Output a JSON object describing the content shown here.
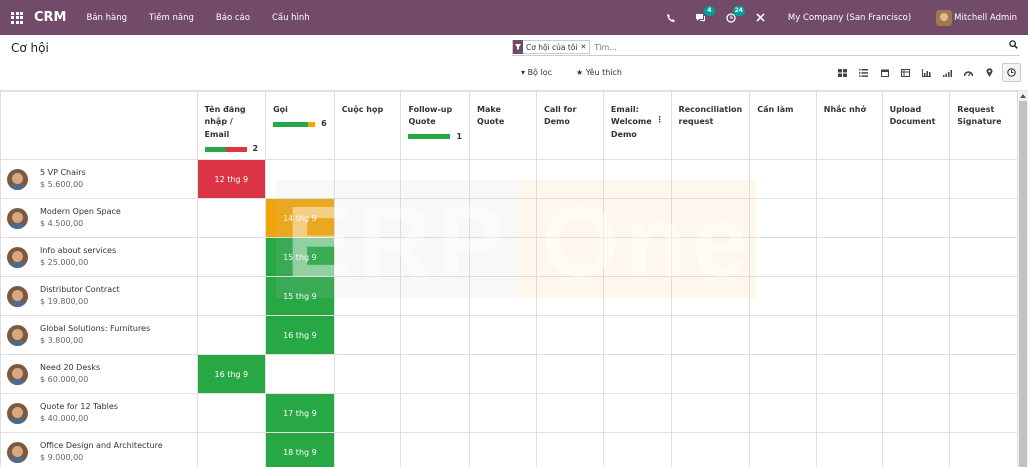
{
  "navbar": {
    "brand": "CRM",
    "menu": [
      "Bán hàng",
      "Tiềm năng",
      "Báo cáo",
      "Cấu hình"
    ],
    "messages_count": "4",
    "activities_count": "24",
    "company": "My Company (San Francisco)",
    "user": "Mitchell Admin"
  },
  "control": {
    "title": "Cơ hội",
    "facet_label": "Cơ hội của tôi",
    "search_placeholder": "Tìm...",
    "filter_label": "Bộ lọc",
    "favorites_label": "Yêu thích",
    "views": [
      "kanban",
      "list",
      "calendar",
      "pivot",
      "graph",
      "cohort",
      "dashboard",
      "map",
      "activity"
    ],
    "active_view": "activity"
  },
  "columns": [
    {
      "label": "Tên đăng nhập / Email",
      "progress": {
        "segments": [
          {
            "color": "#28a745",
            "fraction": 0.5
          },
          {
            "color": "#dc3545",
            "fraction": 0.5
          }
        ],
        "count": "2"
      }
    },
    {
      "label": "Gọi",
      "progress": {
        "segments": [
          {
            "color": "#28a745",
            "fraction": 0.83
          },
          {
            "color": "#f0a30a",
            "fraction": 0.17
          }
        ],
        "count": "6"
      }
    },
    {
      "label": "Cuộc họp"
    },
    {
      "label": "Follow-up Quote",
      "progress": {
        "segments": [
          {
            "color": "#28a745",
            "fraction": 1
          }
        ],
        "count": "1"
      }
    },
    {
      "label": "Make Quote"
    },
    {
      "label": "Call for Demo"
    },
    {
      "label": "Email: Welcome Demo",
      "has_menu": true
    },
    {
      "label": "Reconciliation request"
    },
    {
      "label": "Cần làm"
    },
    {
      "label": "Nhắc nhở"
    },
    {
      "label": "Upload Document"
    },
    {
      "label": "Request Signature"
    }
  ],
  "rows": [
    {
      "name": "5 VP Chairs",
      "amount": "$ 5.600,00",
      "cells": {
        "0": {
          "date": "12 thg 9",
          "status": "overdue"
        }
      }
    },
    {
      "name": "Modern Open Space",
      "amount": "$ 4.500,00",
      "cells": {
        "1": {
          "date": "14 thg 9",
          "status": "today"
        }
      }
    },
    {
      "name": "Info about services",
      "amount": "$ 25.000,00",
      "cells": {
        "1": {
          "date": "15 thg 9",
          "status": "planned"
        }
      }
    },
    {
      "name": "Distributor Contract",
      "amount": "$ 19.800,00",
      "cells": {
        "1": {
          "date": "15 thg 9",
          "status": "planned"
        }
      }
    },
    {
      "name": "Global Solutions: Furnitures",
      "amount": "$ 3.800,00",
      "cells": {
        "1": {
          "date": "16 thg 9",
          "status": "planned"
        }
      }
    },
    {
      "name": "Need 20 Desks",
      "amount": "$ 60.000,00",
      "cells": {
        "0": {
          "date": "16 thg 9",
          "status": "planned"
        }
      }
    },
    {
      "name": "Quote for 12 Tables",
      "amount": "$ 40.000,00",
      "cells": {
        "1": {
          "date": "17 thg 9",
          "status": "planned"
        }
      }
    },
    {
      "name": "Office Design and Architecture",
      "amount": "$ 9.000,00",
      "cells": {
        "1": {
          "date": "18 thg 9",
          "status": "planned"
        }
      }
    }
  ],
  "status_colors": {
    "overdue": "#dc3545",
    "today": "#f0a30a",
    "planned": "#28a745"
  },
  "watermark": "ERP One"
}
